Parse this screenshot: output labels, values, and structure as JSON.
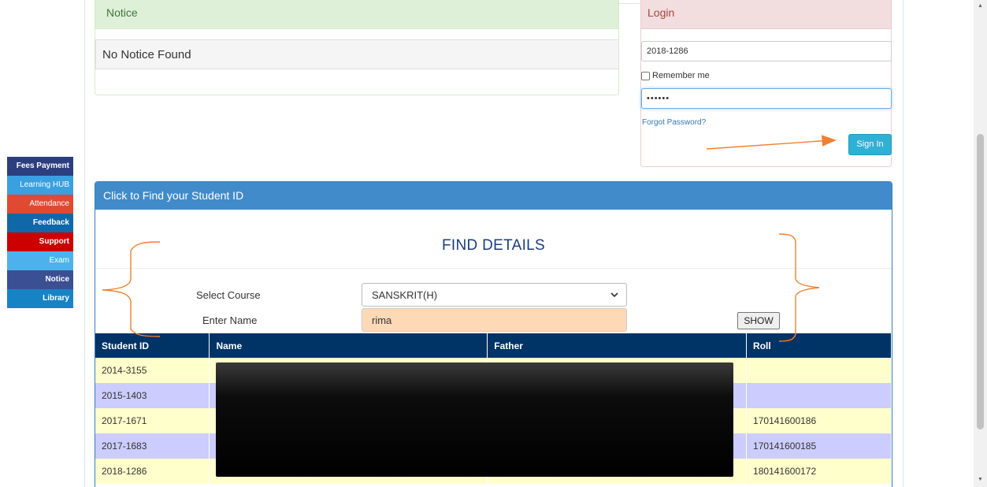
{
  "notice": {
    "heading": "Notice",
    "item": "No Notice Found"
  },
  "login": {
    "heading": "Login",
    "username_value": "2018-1286",
    "remember_label": "Remember me",
    "password_value": "••••••",
    "forgot_label": "Forgot Password?",
    "signin_label": "Sign In"
  },
  "side_menu": [
    {
      "label": "Fees Payment",
      "color": "#2c3e7e"
    },
    {
      "label": "Learning HUB",
      "color": "#3aa0e0"
    },
    {
      "label": "Attendance",
      "color": "#e04a33"
    },
    {
      "label": "Feedback",
      "color": "#1168a8"
    },
    {
      "label": "Support",
      "color": "#cc0000"
    },
    {
      "label": "Exam",
      "color": "#4db2ec"
    },
    {
      "label": "Notice",
      "color": "#3b4f93"
    },
    {
      "label": "Library",
      "color": "#1684c4"
    }
  ],
  "find": {
    "heading": "Click to Find your Student ID",
    "title": "FIND DETAILS",
    "course_label": "Select Course",
    "course_value": "SANSKRIT(H)",
    "name_label": "Enter Name",
    "name_value": "rima",
    "show_label": "SHOW"
  },
  "table": {
    "headers": [
      "Student ID",
      "Name",
      "Father",
      "Roll"
    ],
    "rows": [
      {
        "id": "2014-3155",
        "name": "",
        "father": "",
        "roll": ""
      },
      {
        "id": "2015-1403",
        "name": "",
        "father": "",
        "roll": ""
      },
      {
        "id": "2017-1671",
        "name": "",
        "father": "",
        "roll": "170141600186"
      },
      {
        "id": "2017-1683",
        "name": "",
        "father": "",
        "roll": "170141600185"
      },
      {
        "id": "2018-1286",
        "name": "",
        "father": "",
        "roll": "180141600172"
      }
    ]
  },
  "colors": {
    "annotation": "#f08030",
    "table_header": "#003366",
    "row_odd": "#ffffcc",
    "row_even": "#ccccff"
  }
}
